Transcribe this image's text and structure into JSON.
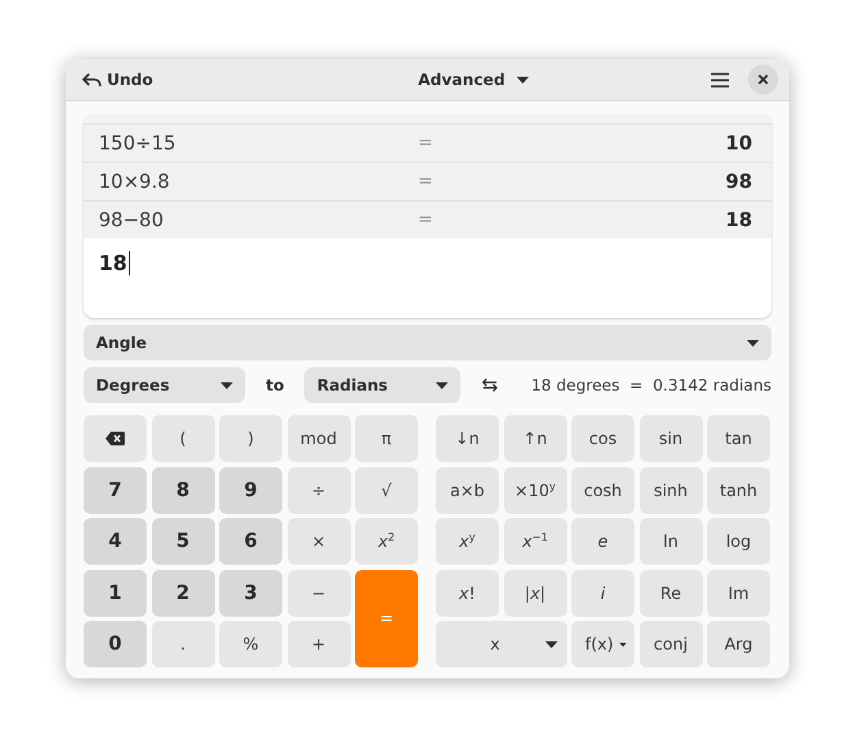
{
  "header": {
    "undo": "Undo",
    "mode": "Advanced"
  },
  "history": [
    {
      "expression": "150÷15",
      "equals": "=",
      "result": "10"
    },
    {
      "expression": "10×9.8",
      "equals": "=",
      "result": "98"
    },
    {
      "expression": "98−80",
      "equals": "=",
      "result": "18"
    }
  ],
  "input": {
    "value": "18"
  },
  "converter": {
    "category": "Angle",
    "from": "Degrees",
    "to_label": "to",
    "to": "Radians",
    "result": "18 degrees  =  0.3142 radians"
  },
  "keypad": {
    "basic": [
      {
        "kind": "backspace"
      },
      {
        "kind": "function",
        "label": "("
      },
      {
        "kind": "function",
        "label": ")"
      },
      {
        "kind": "function",
        "label": "mod"
      },
      {
        "kind": "function",
        "label": "π"
      },
      {
        "kind": "number",
        "label": "7"
      },
      {
        "kind": "number",
        "label": "8"
      },
      {
        "kind": "number",
        "label": "9"
      },
      {
        "kind": "function",
        "label": "÷"
      },
      {
        "kind": "function",
        "label": "√"
      },
      {
        "kind": "number",
        "label": "4"
      },
      {
        "kind": "number",
        "label": "5"
      },
      {
        "kind": "number",
        "label": "6"
      },
      {
        "kind": "function",
        "label": "×"
      },
      {
        "kind": "function",
        "label": "*x*$^{2}$"
      },
      {
        "kind": "number",
        "label": "1"
      },
      {
        "kind": "number",
        "label": "2"
      },
      {
        "kind": "number",
        "label": "3"
      },
      {
        "kind": "function",
        "label": "−"
      },
      {
        "kind": "equals",
        "label": "="
      },
      {
        "kind": "number",
        "label": "0"
      },
      {
        "kind": "function",
        "label": "."
      },
      {
        "kind": "function",
        "label": "%"
      },
      {
        "kind": "function",
        "label": "+"
      }
    ],
    "advanced": [
      {
        "kind": "function",
        "label": "↓n"
      },
      {
        "kind": "function",
        "label": "↑n"
      },
      {
        "kind": "function",
        "label": "cos"
      },
      {
        "kind": "function",
        "label": "sin"
      },
      {
        "kind": "function",
        "label": "tan"
      },
      {
        "kind": "function",
        "label": "a×b"
      },
      {
        "kind": "function",
        "label": "×10$^{y}$"
      },
      {
        "kind": "function",
        "label": "cosh"
      },
      {
        "kind": "function",
        "label": "sinh"
      },
      {
        "kind": "function",
        "label": "tanh"
      },
      {
        "kind": "function",
        "label": "*x*$^{y}$"
      },
      {
        "kind": "function",
        "label": "*x*$^{−1}$"
      },
      {
        "kind": "italic",
        "label": "e"
      },
      {
        "kind": "function",
        "label": "ln"
      },
      {
        "kind": "function",
        "label": "log"
      },
      {
        "kind": "function",
        "label": "*x*!"
      },
      {
        "kind": "function",
        "label": "|*x*|"
      },
      {
        "kind": "italic",
        "label": "i"
      },
      {
        "kind": "function",
        "label": "Re"
      },
      {
        "kind": "function",
        "label": "Im"
      },
      {
        "kind": "widemenu",
        "label": "x"
      },
      {
        "kind": "menu",
        "label": "f(x)"
      },
      {
        "kind": "function",
        "label": "conj"
      },
      {
        "kind": "function",
        "label": "Arg"
      }
    ]
  }
}
